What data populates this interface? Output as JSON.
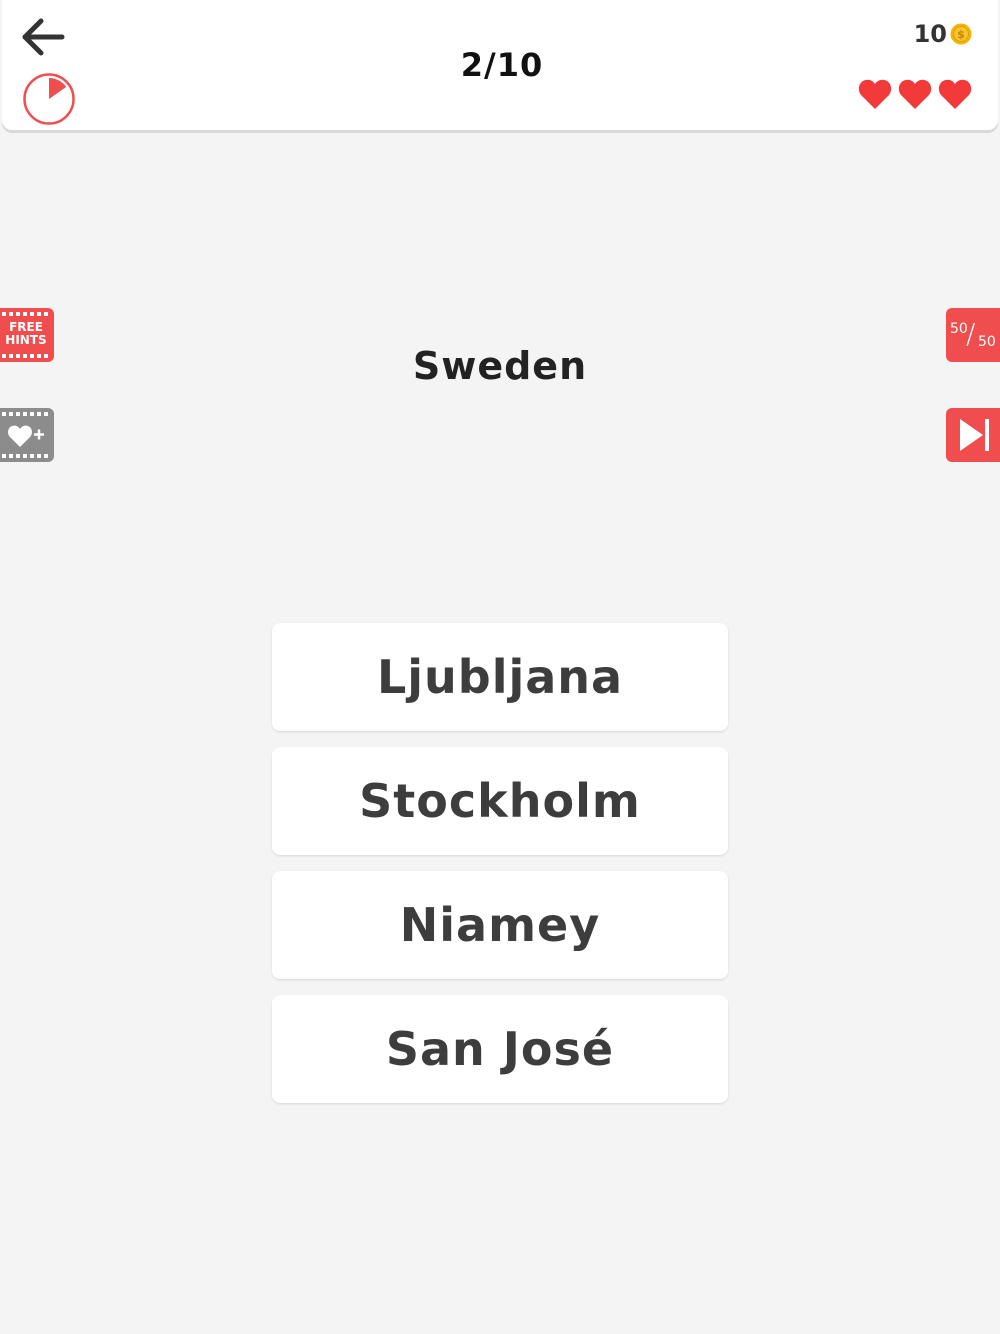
{
  "header": {
    "progress": "2/10",
    "coins": "10",
    "lives": 3
  },
  "question": {
    "text": "Sweden"
  },
  "side_buttons": {
    "free_hints_line1": "FREE",
    "free_hints_line2": "HINTS",
    "fifty_top": "50",
    "fifty_slash": "/",
    "fifty_bottom": "50"
  },
  "answers": [
    {
      "label": "Ljubljana"
    },
    {
      "label": "Stockholm"
    },
    {
      "label": "Niamey"
    },
    {
      "label": "San José"
    }
  ],
  "colors": {
    "accent": "#f04e4e",
    "heart": "#f23a3a",
    "coin": "#f5b400",
    "disabled": "#8c8c8c",
    "background": "#f4f4f4"
  },
  "icons": {
    "back": "arrow-left-icon",
    "timer": "timer-pie-icon",
    "coin": "coin-icon",
    "heart": "heart-icon",
    "extra_life": "heart-plus-icon",
    "skip": "skip-forward-icon"
  }
}
